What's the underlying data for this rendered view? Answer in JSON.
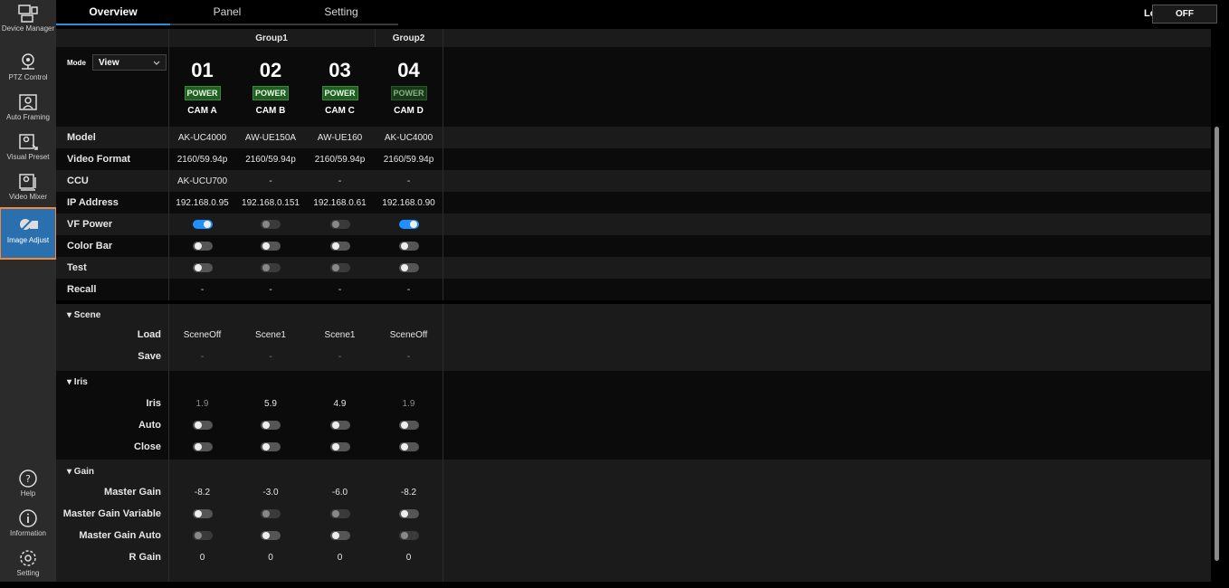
{
  "sidebar": {
    "items": [
      {
        "label": "Device Manager",
        "icon": "device-manager-icon"
      },
      {
        "label": "PTZ Control",
        "icon": "ptz-control-icon"
      },
      {
        "label": "Auto Framing",
        "icon": "auto-framing-icon"
      },
      {
        "label": "Visual Preset",
        "icon": "visual-preset-icon"
      },
      {
        "label": "Video Mixer",
        "icon": "video-mixer-icon"
      },
      {
        "label": "Image Adjust",
        "icon": "image-adjust-icon",
        "active": true
      }
    ],
    "bottom": [
      {
        "label": "Help",
        "icon": "help-icon"
      },
      {
        "label": "Information",
        "icon": "information-icon"
      },
      {
        "label": "Setting",
        "icon": "setting-icon"
      }
    ]
  },
  "tabs": [
    {
      "label": "Overview",
      "active": true
    },
    {
      "label": "Panel"
    },
    {
      "label": "Setting"
    }
  ],
  "lock": {
    "label": "Lock",
    "value": "OFF"
  },
  "mode": {
    "label": "Mode",
    "value": "View"
  },
  "groups": [
    "Group1",
    "Group2"
  ],
  "cameras": [
    {
      "num": "01",
      "power": "POWER",
      "name": "CAM A"
    },
    {
      "num": "02",
      "power": "POWER",
      "name": "CAM B"
    },
    {
      "num": "03",
      "power": "POWER",
      "name": "CAM C"
    },
    {
      "num": "04",
      "power": "POWER",
      "name": "CAM D"
    }
  ],
  "rows": {
    "model": {
      "label": "Model",
      "values": [
        "AK-UC4000",
        "AW-UE150A",
        "AW-UE160",
        "AK-UC4000"
      ]
    },
    "video_format": {
      "label": "Video Format",
      "values": [
        "2160/59.94p",
        "2160/59.94p",
        "2160/59.94p",
        "2160/59.94p"
      ]
    },
    "ccu": {
      "label": "CCU",
      "values": [
        "AK-UCU700",
        "-",
        "-",
        "-"
      ]
    },
    "ip": {
      "label": "IP Address",
      "values": [
        "192.168.0.95",
        "192.168.0.151",
        "192.168.0.61",
        "192.168.0.90"
      ]
    },
    "vf_power": {
      "label": "VF Power"
    },
    "color_bar": {
      "label": "Color Bar"
    },
    "test": {
      "label": "Test"
    },
    "recall": {
      "label": "Recall",
      "values": [
        "-",
        "-",
        "-",
        "-"
      ]
    }
  },
  "scene": {
    "header": "▾ Scene",
    "load": {
      "label": "Load",
      "values": [
        "SceneOff",
        "Scene1",
        "Scene1",
        "SceneOff"
      ]
    },
    "save": {
      "label": "Save",
      "values": [
        "-",
        "-",
        "-",
        "-"
      ]
    }
  },
  "iris": {
    "header": "▾ Iris",
    "iris": {
      "label": "Iris",
      "values": [
        "1.9",
        "5.9",
        "4.9",
        "1.9"
      ]
    },
    "auto": {
      "label": "Auto"
    },
    "close": {
      "label": "Close"
    }
  },
  "gain": {
    "header": "▾ Gain",
    "master_gain": {
      "label": "Master Gain",
      "values": [
        "-8.2",
        "-3.0",
        "-6.0",
        "-8.2"
      ]
    },
    "master_gain_variable": {
      "label": "Master Gain Variable"
    },
    "master_gain_auto": {
      "label": "Master Gain Auto"
    },
    "r_gain": {
      "label": "R Gain",
      "values": [
        "0",
        "0",
        "0",
        "0"
      ]
    }
  }
}
